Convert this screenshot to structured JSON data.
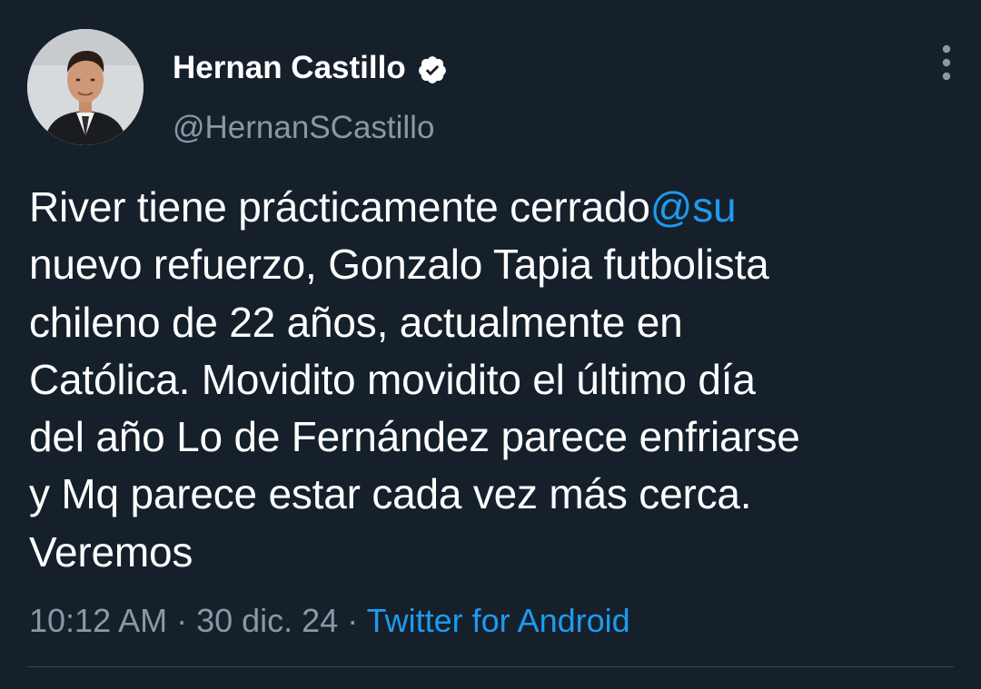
{
  "author": {
    "name": "Hernan Castillo",
    "handle": "@HernanSCastillo",
    "avatar_icon": "profile-photo",
    "verified_icon": "verified-badge-icon"
  },
  "menu": {
    "icon": "more-vertical-icon"
  },
  "tweet": {
    "lines": [
      {
        "text": "River tiene prácticamente cerrado",
        "mention": "@su"
      },
      {
        "text": "nuevo refuerzo, Gonzalo Tapia futbolista"
      },
      {
        "text": "chileno de 22 años, actualmente en"
      },
      {
        "text": "Católica. Movidito movidito el último día"
      },
      {
        "text": "del año Lo de Fernández parece enfriarse"
      },
      {
        "text": "y Mq parece estar cada vez más cerca."
      },
      {
        "text": "Veremos"
      }
    ]
  },
  "meta": {
    "time": "10:12 AM",
    "separator": " · ",
    "date": "30 dic. 24",
    "source": "Twitter for Android"
  },
  "colors": {
    "background": "#15202b",
    "text": "#ffffff",
    "secondary": "#8899a6",
    "accent": "#1d9bf0"
  }
}
